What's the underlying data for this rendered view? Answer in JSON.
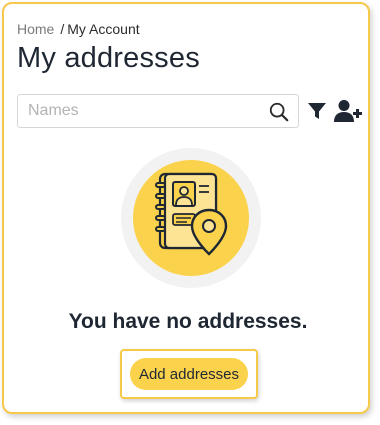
{
  "breadcrumb": {
    "home": "Home",
    "separator": "/",
    "current": "My Account"
  },
  "page": {
    "title": "My addresses"
  },
  "search": {
    "placeholder": "Names",
    "value": "",
    "icon": "search-icon"
  },
  "toolbar": {
    "filter_icon": "filter-icon",
    "add_user_icon": "add-user-icon"
  },
  "empty_state": {
    "illustration": "address-book-with-location-pin",
    "message": "You have no addresses.",
    "button_label": "Add addresses"
  },
  "colors": {
    "accent": "#fbd24c",
    "border_accent": "#f7c94a",
    "text": "#1f2733",
    "muted": "#7a7a7a"
  }
}
